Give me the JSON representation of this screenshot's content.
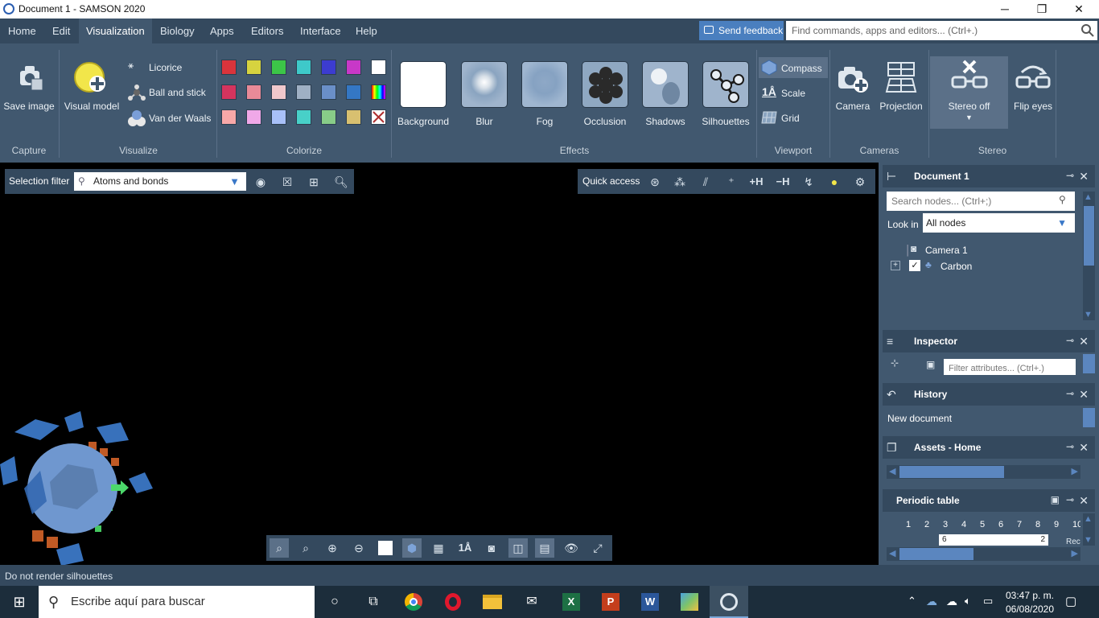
{
  "window": {
    "title": "Document 1 - SAMSON 2020",
    "minimize": "─",
    "maximize": "❐",
    "close": "✕"
  },
  "menu": {
    "tabs": [
      "Home",
      "Edit",
      "Visualization",
      "Biology",
      "Apps",
      "Editors",
      "Interface",
      "Help"
    ],
    "active": "Visualization",
    "feedback_label": "Send feedback",
    "search_placeholder": "Find commands, apps and editors... (Ctrl+.)"
  },
  "ribbon": {
    "capture": {
      "group_label": "Capture",
      "save_image": "Save image"
    },
    "visualize": {
      "group_label": "Visualize",
      "visual_model": "Visual model",
      "licorice": "Licorice",
      "ball_and_stick": "Ball and stick",
      "van_der_waals": "Van der Waals"
    },
    "colorize": {
      "group_label": "Colorize",
      "rows": [
        [
          "#d9343c",
          "#d6d33f",
          "#3cc548",
          "#3ec9c9",
          "#3c3cd0",
          "#c838c8",
          "#ffffff"
        ],
        [
          "#d4345e",
          "#e88a98",
          "#f0c8cc",
          "#9fb0c4",
          "#6a8fc8",
          "#3477c4",
          "rainbow"
        ],
        [
          "#f8a8a8",
          "#f0a8e8",
          "#a8c0f8",
          "#48d0c8",
          "#88cc88",
          "#d8c070",
          "none"
        ]
      ]
    },
    "effects": {
      "group_label": "Effects",
      "items": [
        "Background",
        "Blur",
        "Fog",
        "Occlusion",
        "Shadows",
        "Silhouettes"
      ]
    },
    "viewport": {
      "group_label": "Viewport",
      "compass": "Compass",
      "scale": "Scale",
      "grid": "Grid"
    },
    "cameras": {
      "group_label": "Cameras",
      "camera": "Camera",
      "projection": "Projection"
    },
    "stereo": {
      "group_label": "Stereo",
      "stereo_off": "Stereo off",
      "flip_eyes": "Flip eyes"
    }
  },
  "selection_filter": {
    "label": "Selection filter",
    "value": "Atoms and bonds"
  },
  "quick_access": {
    "label": "Quick access",
    "plus_h": "+H",
    "minus_h": "−H"
  },
  "document_panel": {
    "title": "Document 1",
    "search_placeholder": "Search nodes... (Ctrl+;)",
    "look_in_label": "Look in",
    "look_in_value": "All nodes",
    "nodes": [
      "Camera 1",
      "Carbon"
    ]
  },
  "inspector_panel": {
    "title": "Inspector",
    "filter_placeholder": "Filter attributes... (Ctrl+.)"
  },
  "history_panel": {
    "title": "History",
    "entry": "New document"
  },
  "assets_panel": {
    "title": "Assets - Home"
  },
  "periodic_panel": {
    "title": "Periodic table",
    "columns": [
      "1",
      "2",
      "3",
      "4",
      "5",
      "6",
      "7",
      "8",
      "9",
      "10"
    ],
    "cell_value": "6",
    "cell_right": "2",
    "trailing": "Rec"
  },
  "status": {
    "text": "Do not render silhouettes"
  },
  "taskbar": {
    "search_placeholder": "Escribe aquí para buscar",
    "time": "03:47 p. m.",
    "date": "06/08/2020"
  },
  "colors": {
    "menu_bg": "#34495e",
    "ribbon_bg": "#41586f",
    "accent": "#4a7fbf"
  }
}
